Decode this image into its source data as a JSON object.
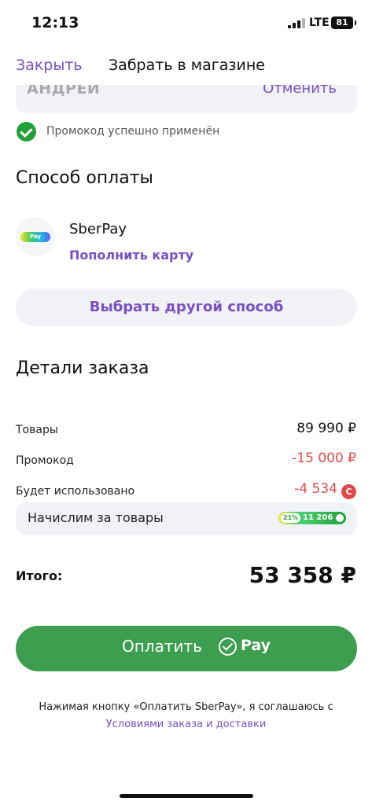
{
  "status": {
    "time": "12:13",
    "network": "LTE",
    "battery": "81"
  },
  "nav": {
    "close_label": "Закрыть",
    "title": "Забрать в магазине"
  },
  "promo_field": {
    "name": "АНДРЕЙ",
    "cancel_label": "Отменить"
  },
  "promo_status": {
    "text": "Промокод успешно применён"
  },
  "payment": {
    "title": "Способ оплаты",
    "method_name": "SberPay",
    "method_badge": "Pay",
    "topup_label": "Пополнить карту",
    "other_method_label": "Выбрать другой способ"
  },
  "order": {
    "title": "Детали заказа",
    "rows": [
      {
        "label": "Товары",
        "value": "89 990 ₽"
      },
      {
        "label": "Промокод",
        "value": "-15 000 ₽"
      },
      {
        "label": "Будет использовано",
        "value": "-4 534"
      }
    ],
    "bonus_coin": "С",
    "accrual": {
      "label": "Начислим за товары",
      "percent": "21%",
      "amount": "11 206"
    },
    "total_label": "Итого:",
    "total_value": "53 358 ₽"
  },
  "pay_button": {
    "label": "Оплатить",
    "pay_word": "Pay"
  },
  "consent": {
    "text": "Нажимая кнопку «Оплатить SberPay», я соглашаюсь с",
    "link": "Условиями заказа и доставки"
  },
  "colors": {
    "accent": "#7b4fc4",
    "success": "#21a038",
    "pay_button": "#3c9e4e",
    "discount": "#e04a4a"
  }
}
